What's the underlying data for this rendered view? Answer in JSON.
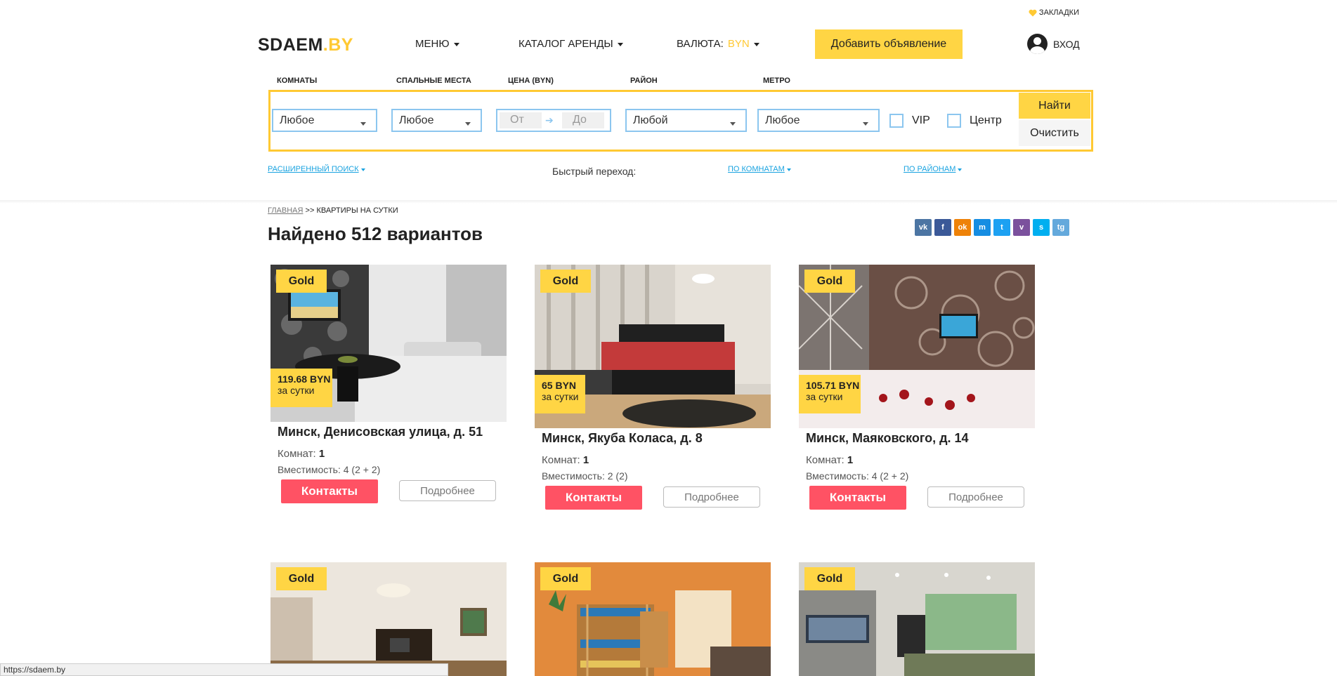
{
  "header": {
    "bookmarks_label": "ЗАКЛАДКИ",
    "logo_main": "SDAEM",
    "logo_dot": ".BY",
    "menu_label": "МЕНЮ",
    "catalog_label": "КАТАЛОГ АРЕНДЫ",
    "currency_label": "ВАЛЮТА:",
    "currency_value": "BYN",
    "add_button": "Добавить объявление",
    "login_label": "ВХОД"
  },
  "filter": {
    "rooms_label": "КОМНАТЫ",
    "beds_label": "СПАЛЬНЫЕ МЕСТА",
    "price_label": "ЦЕНА (BYN)",
    "district_label": "РАЙОН",
    "metro_label": "МЕТРО",
    "rooms_value": "Любое",
    "beds_value": "Любое",
    "price_from_placeholder": "От",
    "price_to_placeholder": "До",
    "district_value": "Любой",
    "metro_value": "Любое",
    "vip_label": "VIP",
    "center_label": "Центр",
    "find_button": "Найти",
    "clear_button": "Очистить"
  },
  "quick_links": {
    "advanced_search": "РАСШИРЕННЫЙ ПОИСК",
    "quick_jump": "Быстрый переход:",
    "by_rooms": "ПО КОМНАТАМ",
    "by_districts": "ПО РАЙОНАМ"
  },
  "breadcrumb": {
    "home": "ГЛАВНАЯ",
    "separator": ">>",
    "current": "КВАРТИРЫ НА СУТКИ"
  },
  "page_title": "Найдено 512 вариантов",
  "share": [
    {
      "label": "vk",
      "color": "#4c75a3"
    },
    {
      "label": "f",
      "color": "#3b5998"
    },
    {
      "label": "ok",
      "color": "#ee8208"
    },
    {
      "label": "m",
      "color": "#168de2"
    },
    {
      "label": "t",
      "color": "#1da1f2"
    },
    {
      "label": "v",
      "color": "#7b519d"
    },
    {
      "label": "s",
      "color": "#00aff0"
    },
    {
      "label": "tg",
      "color": "#64a9dc"
    }
  ],
  "listings": [
    {
      "badge": "Gold",
      "price": "119.68 BYN",
      "per": "за сутки",
      "address": "Минск, Денисовская улица, д. 51",
      "rooms_label": "Комнат:",
      "rooms": "1",
      "capacity_label": "Вместимость:",
      "capacity": "4 (2 + 2)",
      "contacts": "Контакты",
      "more": "Подробнее"
    },
    {
      "badge": "Gold",
      "price": "65 BYN",
      "per": "за сутки",
      "address": "Минск, Якуба Коласа, д. 8",
      "rooms_label": "Комнат:",
      "rooms": "1",
      "capacity_label": "Вместимость:",
      "capacity": "2 (2)",
      "contacts": "Контакты",
      "more": "Подробнее"
    },
    {
      "badge": "Gold",
      "price": "105.71 BYN",
      "per": "за сутки",
      "address": "Минск, Маяковского, д. 14",
      "rooms_label": "Комнат:",
      "rooms": "1",
      "capacity_label": "Вместимость:",
      "capacity": "4 (2 + 2)",
      "contacts": "Контакты",
      "more": "Подробнее"
    },
    {
      "badge": "Gold"
    },
    {
      "badge": "Gold"
    },
    {
      "badge": "Gold"
    }
  ],
  "status_bar": "https://sdaem.by",
  "colors": {
    "accent": "#ffd544",
    "link": "#1aa3e0",
    "contacts": "#ff5264",
    "field_border": "#8cc6ef"
  }
}
